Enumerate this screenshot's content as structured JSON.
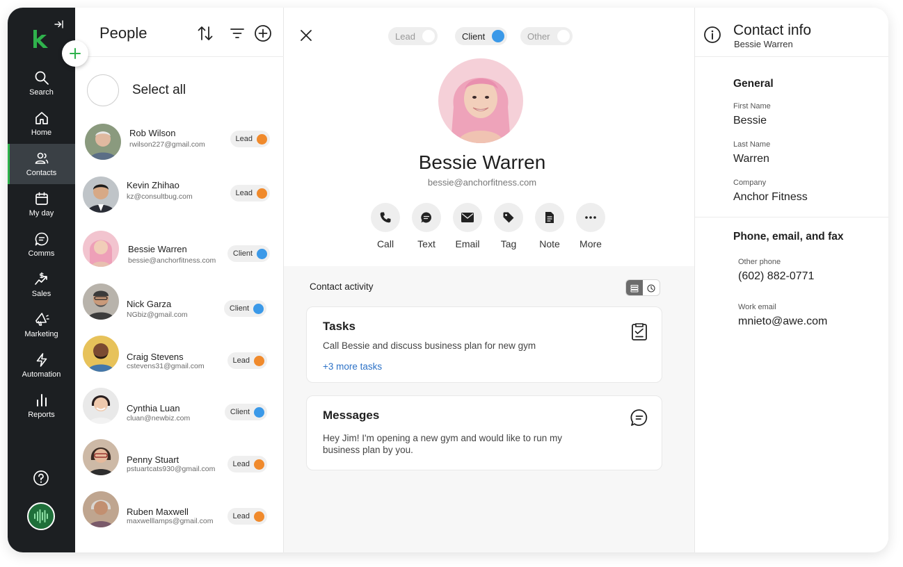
{
  "sidebar": {
    "items": [
      {
        "label": "Search",
        "icon": "search-icon"
      },
      {
        "label": "Home",
        "icon": "home-icon"
      },
      {
        "label": "Contacts",
        "icon": "contacts-icon"
      },
      {
        "label": "My day",
        "icon": "calendar-icon"
      },
      {
        "label": "Comms",
        "icon": "chat-icon"
      },
      {
        "label": "Sales",
        "icon": "sales-icon"
      },
      {
        "label": "Marketing",
        "icon": "megaphone-icon"
      },
      {
        "label": "Automation",
        "icon": "lightning-icon"
      },
      {
        "label": "Reports",
        "icon": "bar-chart-icon"
      }
    ],
    "active": "Contacts"
  },
  "people": {
    "title": "People",
    "select_all": "Select all",
    "contacts": [
      {
        "name": "Rob Wilson",
        "email": "rwilson227@gmail.com",
        "status": "Lead"
      },
      {
        "name": "Kevin Zhihao",
        "email": "kz@consultbug.com",
        "status": "Lead"
      },
      {
        "name": "Bessie Warren",
        "email": "bessie@anchorfitness.com",
        "status": "Client"
      },
      {
        "name": "Nick Garza",
        "email": "NGbiz@gmail.com",
        "status": "Client"
      },
      {
        "name": "Craig Stevens",
        "email": "cstevens31@gmail.com",
        "status": "Lead"
      },
      {
        "name": "Cynthia Luan",
        "email": "cluan@newbiz.com",
        "status": "Client"
      },
      {
        "name": "Penny Stuart",
        "email": "pstuartcats930@gmail.com",
        "status": "Lead"
      },
      {
        "name": "Ruben Maxwell",
        "email": "maxwelllamps@gmail.com",
        "status": "Lead"
      }
    ]
  },
  "detail": {
    "status_options": [
      "Lead",
      "Client",
      "Other"
    ],
    "selected_status": "Client",
    "name": "Bessie Warren",
    "email": "bessie@anchorfitness.com",
    "actions": [
      "Call",
      "Text",
      "Email",
      "Tag",
      "Note",
      "More"
    ],
    "activity_title": "Contact activity",
    "tasks": {
      "title": "Tasks",
      "text": "Call Bessie and discuss business plan for new gym",
      "link": "+3 more tasks"
    },
    "messages": {
      "title": "Messages",
      "text": "Hey Jim! I'm opening a new gym and would like to run my business plan by you."
    }
  },
  "info": {
    "title": "Contact info",
    "subtitle": "Bessie Warren",
    "general_title": "General",
    "first_name_label": "First Name",
    "first_name": "Bessie",
    "last_name_label": "Last Name",
    "last_name": "Warren",
    "company_label": "Company",
    "company": "Anchor Fitness",
    "contact_title": "Phone, email, and fax",
    "other_phone_label": "Other phone",
    "other_phone": "(602) 882-0771",
    "work_email_label": "Work email",
    "work_email": "mnieto@awe.com"
  },
  "colors": {
    "lead": "#f08a2c",
    "client": "#3b99e8",
    "brand_green": "#2fb24c",
    "sidebar_bg": "#1c1f22",
    "link": "#2d72c7"
  }
}
